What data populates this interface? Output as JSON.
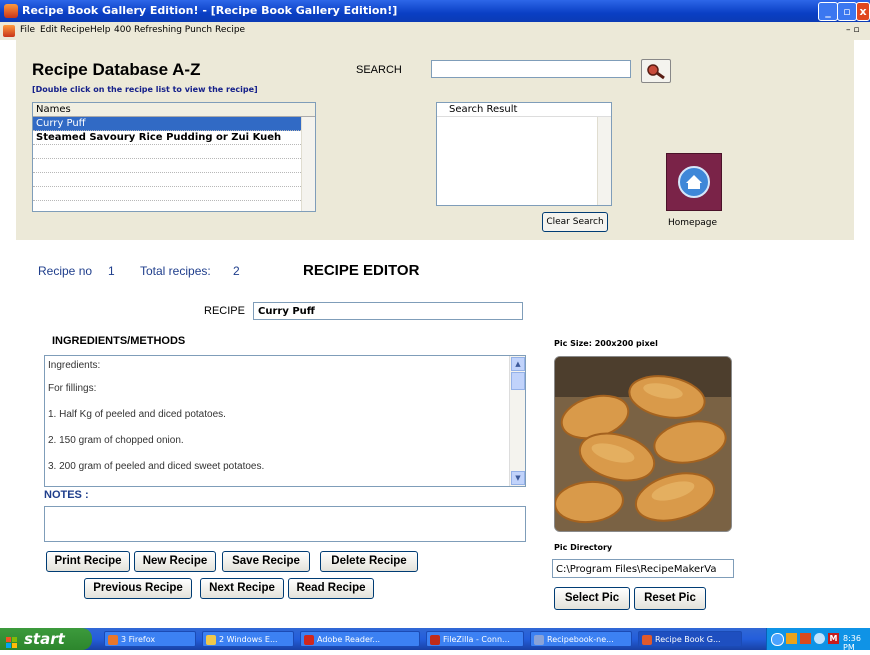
{
  "window": {
    "title": "Recipe Book Gallery Edition! - [Recipe Book Gallery Edition!]",
    "controls": [
      "_",
      "▫",
      "x"
    ]
  },
  "menu": [
    "File",
    "Edit",
    "Recipe",
    "Help",
    "400 Refreshing Punch Recipe"
  ],
  "top": {
    "heading": "Recipe Database A-Z",
    "hint": "[Double click on the recipe list to view the recipe]",
    "names_header": "Names",
    "names": [
      "Curry Puff",
      "Steamed Savoury Rice Pudding or Zui Kueh"
    ],
    "search_label": "SEARCH",
    "search_value": "",
    "search_result_header": "Search Result",
    "clear_search": "Clear Search",
    "homepage": "Homepage"
  },
  "editor": {
    "recipe_no_label": "Recipe no",
    "recipe_no": "1",
    "total_label": "Total recipes:",
    "total": "2",
    "title": "RECIPE EDITOR",
    "recipe_label": "RECIPE",
    "recipe_value": "Curry Puff",
    "ingredients_label": "INGREDIENTS/METHODS",
    "ingredients_lines": [
      "Ingredients:",
      "For fillings:",
      "1. Half Kg of peeled and diced potatoes.",
      "2. 150 gram of chopped onion.",
      "3. 200 gram of peeled and diced sweet potatoes."
    ],
    "notes_label": "NOTES :",
    "notes_value": "",
    "pic_size_label": "Pic Size: 200x200 pixel",
    "pic_dir_label": "Pic Directory",
    "pic_dir_value": "C:\\Program Files\\RecipeMakerVa",
    "buttons": {
      "print": "Print Recipe",
      "new": "New Recipe",
      "save": "Save Recipe",
      "delete": "Delete Recipe",
      "previous": "Previous Recipe",
      "next": "Next Recipe",
      "read": "Read Recipe",
      "select_pic": "Select Pic",
      "reset_pic": "Reset Pic"
    }
  },
  "taskbar": {
    "start": "start",
    "items": [
      {
        "label": "3 Firefox",
        "icon": "firefox-icon",
        "color": "#e8762b"
      },
      {
        "label": "2 Windows E...",
        "icon": "folder-icon",
        "color": "#f1c84b"
      },
      {
        "label": "Adobe Reader...",
        "icon": "pdf-icon",
        "color": "#d0271d"
      },
      {
        "label": "FileZilla - Conn...",
        "icon": "filezilla-icon",
        "color": "#bf2b1a"
      },
      {
        "label": "Recipebook-ne...",
        "icon": "app-icon",
        "color": "#8aa3d8"
      },
      {
        "label": "Recipe Book G...",
        "icon": "recipe-app-icon",
        "color": "#e05a2c"
      }
    ],
    "clock": "8:36 PM"
  },
  "colors": {
    "panel": "#ece9d8",
    "accent": "#316ac5",
    "label_blue": "#1f3e8c"
  }
}
